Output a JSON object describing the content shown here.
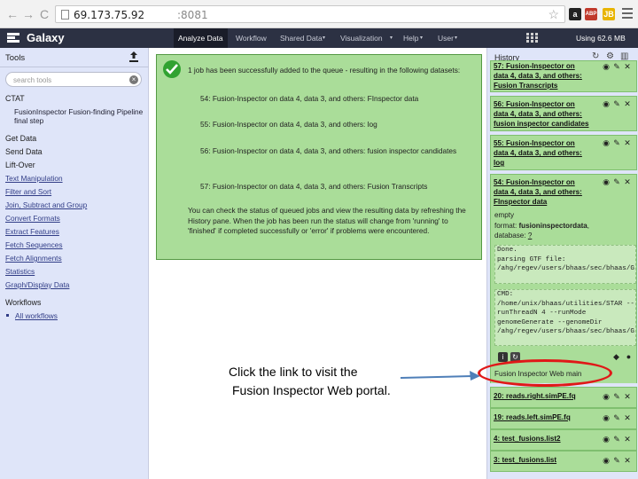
{
  "browser": {
    "back_glyph": "←",
    "forward_glyph": "→",
    "reload_glyph": "C",
    "url_host": "69.173.75.92",
    "url_port": ":8081",
    "star_glyph": "☆",
    "ext_amazon": "a",
    "ext_adblock": "ABP",
    "ext_other": "JB"
  },
  "masthead": {
    "brand": "Galaxy",
    "tabs": [
      "Analyze Data",
      "Workflow",
      "Shared Data",
      "Visualization",
      "Help",
      "User"
    ],
    "usage": "Using 62.6 MB"
  },
  "tools": {
    "title": "Tools",
    "search_placeholder": "search tools",
    "sections": {
      "ctat": "CTAT",
      "fusion_tool": "FusionInspector Fusion-finding Pipeline final step",
      "workflows": "Workflows",
      "all_workflows": "All workflows"
    },
    "links": [
      "Get Data",
      "Send Data",
      "Lift-Over",
      "Text Manipulation",
      "Filter and Sort",
      "Join, Subtract and Group",
      "Convert Formats",
      "Extract Features",
      "Fetch Sequences",
      "Fetch Alignments",
      "Statistics",
      "Graph/Display Data"
    ]
  },
  "center": {
    "intro": "1 job has been successfully added to the queue - resulting in the following datasets:",
    "items": [
      "54: Fusion-Inspector on data 4, data 3, and others: FInspector data",
      "55: Fusion-Inspector on data 4, data 3, and others: log",
      "56: Fusion-Inspector on data 4, data 3, and others: fusion inspector candidates",
      "57: Fusion-Inspector on data 4, data 3, and others: Fusion Transcripts"
    ],
    "footer": "You can check the status of queued jobs and view the resulting data by refreshing the History pane. When the job has been run the status will change from 'running' to 'finished' if completed successfully or 'error' if problems were encountered."
  },
  "annotation": {
    "line1": "Click the link to visit the",
    "line2": "Fusion Inspector Web portal."
  },
  "history": {
    "title": "History",
    "datasets": [
      {
        "title": "57: Fusion-Inspector on data 4, data 3, and others: Fusion Transcripts"
      },
      {
        "title": "56: Fusion-Inspector on data 4, data 3, and others: fusion inspector candidates"
      },
      {
        "title": "55: Fusion-Inspector on data 4, data 3, and others: log"
      },
      {
        "title": "54: Fusion-Inspector on data 4, data 3, and others: FInspector data"
      }
    ],
    "expanded": {
      "status": "empty",
      "format_label": "format:",
      "format_value": "fusioninspectordata",
      "database_label": "database:",
      "database_value": "?",
      "peek1": [
        "Done.",
        "parsing GTF file:",
        "/ahg/regev/users/bhaas/sec/bhaas/G"
      ],
      "peek2": [
        "CMD:",
        "/home/unix/bhaas/utilities/STAR --",
        "runThreadN 4 --runMode",
        "genomeGenerate --genomeDir",
        "/ahg/regev/users/bhaas/sec/bhaas/G"
      ],
      "link_text": "Fusion Inspector Web main"
    },
    "lower_datasets": [
      {
        "title": "20: reads.right.simPE.fq"
      },
      {
        "title": "19: reads.left.simPE.fq"
      },
      {
        "title": "4: test_fusions.list2"
      },
      {
        "title": "3: test_fusions.list"
      }
    ]
  },
  "colors": {
    "masthead": "#2c3143",
    "panel": "#dfe5f9",
    "ok_green": "#aadd99",
    "highlight_red": "#e01818",
    "arrow_blue": "#4f7fb8"
  }
}
